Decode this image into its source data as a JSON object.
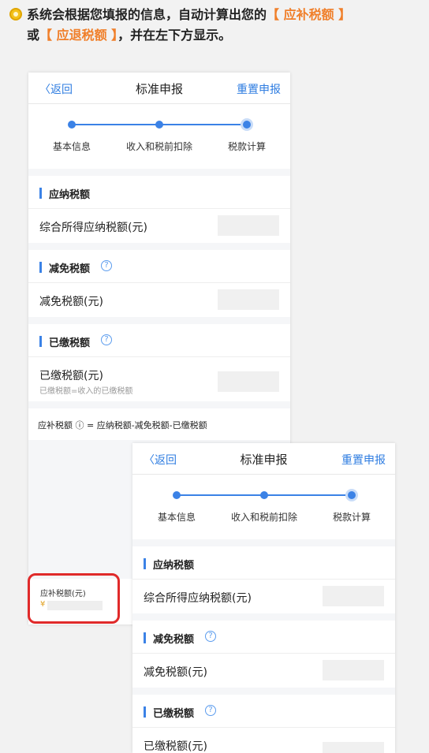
{
  "intro": {
    "line1_text": "系统会根据您填报的信息，自动计算出您的",
    "line1_highlight": "【 应补税额 】",
    "line2_prefix": "或",
    "line2_highlight": "【 应退税额 】",
    "line2_suffix": "，并在左下方显示。"
  },
  "screen": {
    "back_label": "〈返回",
    "title": "标准申报",
    "reset_label": "重置申报",
    "steps": [
      "基本信息",
      "收入和税前扣除",
      "税款计算"
    ],
    "sections": {
      "payable": {
        "title": "应纳税额",
        "row_label": "综合所得应纳税额(元)"
      },
      "reduction": {
        "title": "减免税额",
        "row_label": "减免税额(元)"
      },
      "paid": {
        "title": "已缴税额",
        "row_label": "已缴税额(元)",
        "row_sub": "已缴税额=收入的已缴税额"
      }
    },
    "formula": "应补税额 ⓘ = 应纳税额-减免税额-已缴税额",
    "bottom": {
      "label": "应补税额(元)",
      "currency": "¥"
    },
    "help_icon": "?"
  },
  "colors": {
    "accent": "#2f7de1",
    "highlight": "#f07f2a",
    "ring": "#e02a2a"
  }
}
